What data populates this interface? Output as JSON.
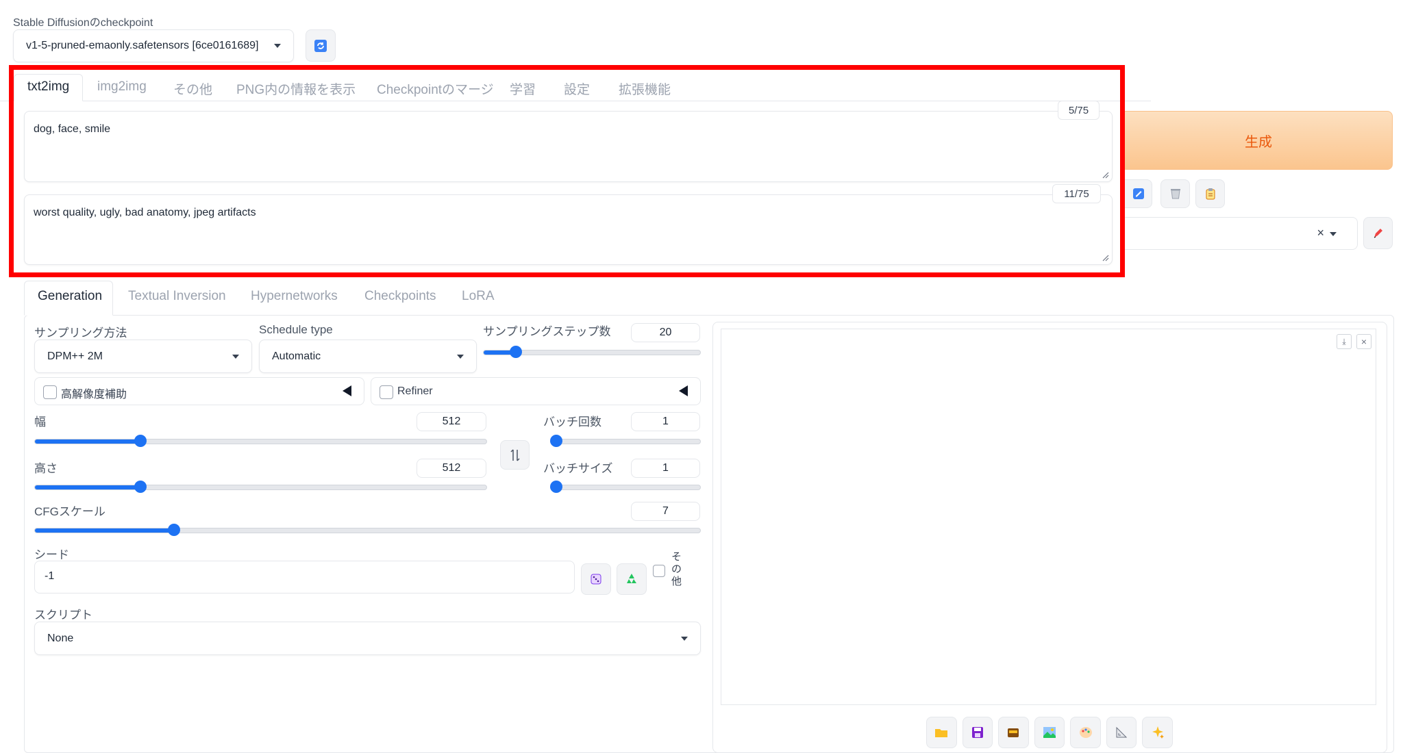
{
  "checkpoint": {
    "label": "Stable Diffusionのcheckpoint",
    "value": "v1-5-pruned-emaonly.safetensors [6ce0161689]"
  },
  "tabs": [
    "txt2img",
    "img2img",
    "その他",
    "PNG内の情報を表示",
    "Checkpointのマージ",
    "学習",
    "設定",
    "拡張機能"
  ],
  "prompt": {
    "value": "dog, face, smile",
    "token_count": "5/75"
  },
  "negative_prompt": {
    "value": "worst quality, ugly, bad anatomy, jpeg artifacts",
    "token_count": "11/75"
  },
  "generate_label": "生成",
  "subtabs": [
    "Generation",
    "Textual Inversion",
    "Hypernetworks",
    "Checkpoints",
    "LoRA"
  ],
  "sampling": {
    "method_label": "サンプリング方法",
    "method_value": "DPM++ 2M",
    "schedule_label": "Schedule type",
    "schedule_value": "Automatic",
    "steps_label": "サンプリングステップ数",
    "steps_value": "20",
    "steps_fraction": 0.15
  },
  "hires_label": "高解像度補助",
  "refiner_label": "Refiner",
  "width": {
    "label": "幅",
    "value": "512",
    "fraction": 0.235
  },
  "height": {
    "label": "高さ",
    "value": "512",
    "fraction": 0.235
  },
  "batch_count": {
    "label": "バッチ回数",
    "value": "1",
    "fraction": 0.0
  },
  "batch_size": {
    "label": "バッチサイズ",
    "value": "1",
    "fraction": 0.0
  },
  "cfg": {
    "label": "CFGスケール",
    "value": "7",
    "fraction": 0.21
  },
  "seed": {
    "label": "シード",
    "value": "-1",
    "extra_label": "その他"
  },
  "script": {
    "label": "スクリプト",
    "value": "None"
  },
  "accent_color": "#1d72f3",
  "generate_color": "#fcd0a1",
  "highlight_color": "#ff0000",
  "icons": {
    "refresh": "refresh-icon",
    "dice": "dice-icon",
    "recycle": "recycle-icon",
    "swap": "swap-icon",
    "output_toolbar": [
      "folder-icon",
      "save-icon",
      "zip-icon",
      "image-icon",
      "palette-icon",
      "ruler-icon",
      "sparkle-icon"
    ]
  }
}
